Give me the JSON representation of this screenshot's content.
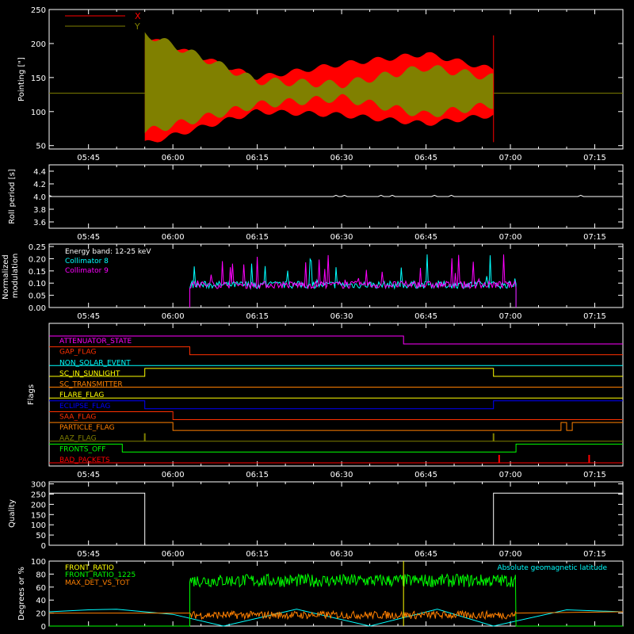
{
  "time_ticks": [
    "05:45",
    "06:00",
    "06:15",
    "06:30",
    "06:45",
    "07:00",
    "07:15"
  ],
  "colors": {
    "bg": "#000000",
    "axis": "#ffffff",
    "x": "#ff0000",
    "y": "#808000",
    "white": "#ffffff",
    "cyan": "#00ffff",
    "magenta": "#ff00ff",
    "orange": "#ff8000",
    "green": "#00ff00",
    "yellow": "#ffff00",
    "blue": "#0000ff"
  },
  "chart_data": [
    {
      "type": "area",
      "ylabel": "Pointing [\"]",
      "ylim": [
        45,
        250
      ],
      "yticks": [
        50,
        100,
        150,
        200,
        250
      ],
      "legend": [
        "X",
        "Y"
      ],
      "series": [
        {
          "name": "X",
          "baseline": 127,
          "envelope_time": [
            "05:55",
            "06:15",
            "06:30",
            "06:45",
            "06:57"
          ],
          "envelope_low": [
            53,
            100,
            95,
            82,
            95
          ],
          "envelope_high": [
            210,
            150,
            170,
            185,
            162
          ]
        },
        {
          "name": "Y",
          "baseline": 127,
          "envelope_time": [
            "05:55",
            "06:15",
            "06:30",
            "06:45",
            "06:57"
          ],
          "envelope_low": [
            70,
            110,
            120,
            95,
            110
          ],
          "envelope_high": [
            215,
            145,
            140,
            165,
            150
          ]
        }
      ],
      "active_range": [
        "05:55",
        "06:57"
      ]
    },
    {
      "type": "line",
      "ylabel": "Roll period [s]",
      "ylim": [
        3.5,
        4.5
      ],
      "yticks": [
        "3.6",
        "3.8",
        "4.0",
        "4.2",
        "4.4"
      ],
      "series": [
        {
          "name": "",
          "value": 4.0
        }
      ]
    },
    {
      "type": "line",
      "ylabel": "Normalized\nmodulation",
      "ylim": [
        0,
        0.26
      ],
      "yticks": [
        "0.00",
        "0.05",
        "0.10",
        "0.15",
        "0.20",
        "0.25"
      ],
      "legend_title": "Energy band: 12-25 keV",
      "series": [
        {
          "name": "Collimator 8",
          "color": "cyan",
          "level": 0.09,
          "range": [
            "06:03",
            "07:01"
          ]
        },
        {
          "name": "Collimator 9",
          "color": "magenta",
          "level": 0.09,
          "range": [
            "06:03",
            "07:01"
          ]
        }
      ]
    },
    {
      "type": "line",
      "ylabel": "Flags",
      "flags": [
        {
          "name": "ATTENUATOR_STATE",
          "color": "#ff00ff",
          "transitions": [
            [
              "05:38",
              1
            ],
            [
              "06:41",
              0
            ]
          ]
        },
        {
          "name": "GAP_FLAG",
          "color": "#ff3000",
          "transitions": [
            [
              "05:38",
              1
            ],
            [
              "06:03",
              0
            ]
          ]
        },
        {
          "name": "NON_SOLAR_EVENT",
          "color": "#00ffff",
          "transitions": [
            [
              "05:38",
              0
            ]
          ]
        },
        {
          "name": "SC_IN_SUNLIGHT",
          "color": "#ffff00",
          "transitions": [
            [
              "05:38",
              0
            ],
            [
              "05:55",
              1
            ],
            [
              "06:57",
              0
            ]
          ]
        },
        {
          "name": "SC_TRANSMITTER",
          "color": "#ff8000",
          "transitions": [
            [
              "05:38",
              0
            ]
          ]
        },
        {
          "name": "FLARE_FLAG",
          "color": "#ffff00",
          "transitions": [
            [
              "05:38",
              0
            ]
          ]
        },
        {
          "name": "ECLIPSE_FLAG",
          "color": "#0000ff",
          "transitions": [
            [
              "05:38",
              1
            ],
            [
              "05:55",
              0
            ],
            [
              "06:57",
              1
            ]
          ]
        },
        {
          "name": "SAA_FLAG",
          "color": "#ff3000",
          "transitions": [
            [
              "05:38",
              1
            ],
            [
              "06:00",
              0
            ]
          ]
        },
        {
          "name": "PARTICLE_FLAG",
          "color": "#ff8000",
          "transitions": [
            [
              "05:38",
              1
            ],
            [
              "06:00",
              0
            ],
            [
              "07:09",
              1
            ],
            [
              "07:10",
              0
            ],
            [
              "07:11",
              1
            ]
          ]
        },
        {
          "name": "AAZ_FLAG",
          "color": "#808000",
          "transitions": [
            [
              "05:38",
              0
            ]
          ],
          "spikes": [
            "05:55",
            "06:57"
          ]
        },
        {
          "name": "FRONTS_OFF",
          "color": "#00ff00",
          "transitions": [
            [
              "05:38",
              1
            ],
            [
              "05:51",
              0
            ],
            [
              "07:01",
              1
            ]
          ]
        },
        {
          "name": "BAD_PACKETS",
          "color": "#ff0000",
          "transitions": [
            [
              "05:38",
              0
            ]
          ],
          "spikes": [
            "06:58",
            "07:14"
          ]
        }
      ]
    },
    {
      "type": "line",
      "ylabel": "Quality",
      "ylim": [
        0,
        310
      ],
      "yticks": [
        0,
        50,
        100,
        150,
        200,
        250,
        300
      ],
      "series": [
        {
          "name": "",
          "steps": [
            [
              "05:38",
              255
            ],
            [
              "05:55",
              0
            ],
            [
              "06:57",
              255
            ]
          ]
        }
      ]
    },
    {
      "type": "line",
      "ylabel": "Degrees or %",
      "ylim": [
        0,
        100
      ],
      "yticks": [
        0,
        20,
        40,
        60,
        80,
        100
      ],
      "legend": [
        "FRONT_RATIO",
        "FRONT_RATIO_1225",
        "MAX_DET_VS_TOT"
      ],
      "legend_right": "Absolute geomagnetic latitude",
      "series": [
        {
          "name": "FRONT_RATIO",
          "color": "yellow",
          "spike": "06:41"
        },
        {
          "name": "FRONT_RATIO_1225",
          "color": "green",
          "level": 70,
          "range": [
            "06:03",
            "07:01"
          ]
        },
        {
          "name": "MAX_DET_VS_TOT",
          "color": "orange",
          "level": 17,
          "range": [
            "06:03",
            "07:01"
          ]
        },
        {
          "name": "Absolute geomagnetic latitude",
          "color": "cyan",
          "points": [
            [
              "05:38",
              22
            ],
            [
              "05:45",
              25
            ],
            [
              "05:50",
              26
            ],
            [
              "06:00",
              18
            ],
            [
              "06:09",
              0
            ],
            [
              "06:22",
              26
            ],
            [
              "06:35",
              0
            ],
            [
              "06:47",
              26
            ],
            [
              "06:57",
              0
            ],
            [
              "07:10",
              25
            ],
            [
              "07:20",
              22
            ]
          ]
        }
      ]
    }
  ]
}
